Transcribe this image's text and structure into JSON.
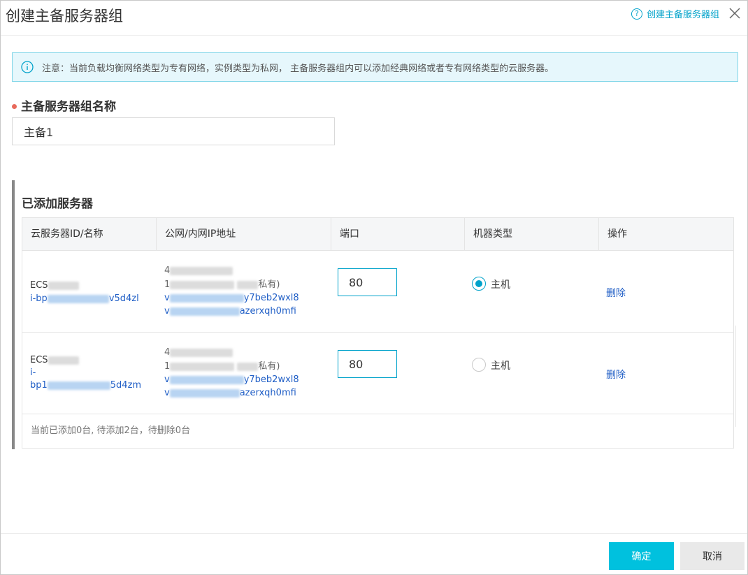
{
  "header": {
    "title": "创建主备服务器组",
    "help_link": "创建主备服务器组",
    "help_icon": "question-circle-icon",
    "close_icon": "close-icon"
  },
  "notice": {
    "icon": "info-circle-icon",
    "text": "注意：当前负载均衡网络类型为专有网络，实例类型为私网， 主备服务器组内可以添加经典网络或者专有网络类型的云服务器。"
  },
  "form": {
    "name_label": "主备服务器组名称",
    "name_value": "主备1"
  },
  "servers": {
    "section_title": "已添加服务器",
    "columns": [
      "云服务器ID/名称",
      "公网/内网IP地址",
      "端口",
      "机器类型",
      "操作"
    ],
    "rows": [
      {
        "name_prefix": "ECS",
        "id_prefix": "i-bp",
        "id_suffix": "v5d4zl",
        "ip_line1": "4",
        "ip_line2_prefix": "1",
        "ip_line2_suffix": "私有)",
        "ip_line3_prefix": "v",
        "ip_line3_suffix": "y7beb2wxl8",
        "ip_line4_prefix": "v",
        "ip_line4_suffix": "azerxqh0mfi",
        "port": "80",
        "machine_type": "主机",
        "selected": true,
        "action": "删除"
      },
      {
        "name_prefix": "ECS",
        "id_prefix": "i-",
        "id_line2_prefix": "bp1",
        "id_suffix": "5d4zm",
        "ip_line1": "4",
        "ip_line2_prefix": "1",
        "ip_line2_suffix": "私有)",
        "ip_line3_prefix": "v",
        "ip_line3_suffix": "y7beb2wxl8",
        "ip_line4_prefix": "v",
        "ip_line4_suffix": "azerxqh0mfi",
        "port": "80",
        "machine_type": "主机",
        "selected": false,
        "action": "删除"
      }
    ],
    "summary": "当前已添加0台, 待添加2台，待删除0台"
  },
  "footer": {
    "ok_label": "确定",
    "cancel_label": "取消"
  },
  "colors": {
    "accent": "#00c1de",
    "link": "#1f5ec6",
    "required": "#e86a5c",
    "notice_bg": "#e6f7fc"
  }
}
